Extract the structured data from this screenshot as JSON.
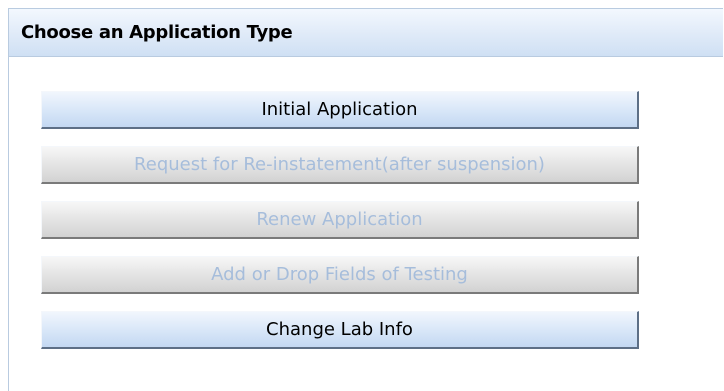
{
  "panel": {
    "title": "Choose an Application Type"
  },
  "buttons": [
    {
      "label": "Initial Application",
      "enabled": true
    },
    {
      "label": "Request for Re-instatement(after suspension)",
      "enabled": false
    },
    {
      "label": "Renew Application",
      "enabled": false
    },
    {
      "label": "Add or Drop Fields of Testing",
      "enabled": false
    },
    {
      "label": "Change Lab Info",
      "enabled": true
    }
  ],
  "colors": {
    "enabled_text": "#000000",
    "disabled_text": "#a6bddb",
    "header_accent": "#dfeaf8",
    "border": "#b9cbe0"
  }
}
